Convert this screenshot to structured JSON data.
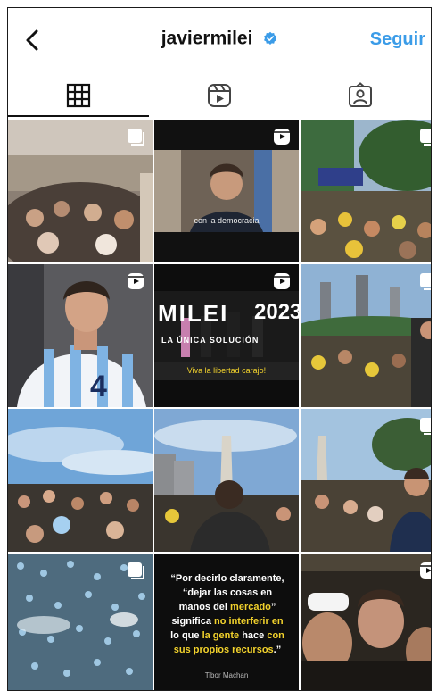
{
  "header": {
    "username": "javiermilei",
    "follow_label": "Seguir"
  },
  "tabs": [
    {
      "name": "grid",
      "icon": "grid-icon"
    },
    {
      "name": "reels",
      "icon": "reels-icon"
    },
    {
      "name": "tagged",
      "icon": "tagged-icon"
    }
  ],
  "posts": {
    "p2_caption": "con la democracia",
    "p5_banner": "MILEI",
    "p5_year": "2023",
    "p5_sub": "LA ÚNICA SOLUCIÓN",
    "p5_caption": "Viva la libertad carajo!",
    "p4_number": "4",
    "p11": {
      "quote_open": "“Por decirlo claramente,",
      "quote_line2": "“dejar las cosas en",
      "quote_line3_a": "manos del ",
      "quote_line3_b": "mercado",
      "quote_line3_c": "”",
      "quote_line4": "significa ",
      "quote_line4_hl": "no interferir en",
      "quote_line5_a": "lo que ",
      "quote_line5_hl": "la gente",
      "quote_line5_b": " hace ",
      "quote_line5_hl2": "con",
      "quote_line6_hl": "sus propios recursos",
      "quote_line6_end": ".”",
      "author": "Tibor Machan"
    }
  },
  "colors": {
    "accent": "#3b9ce8",
    "verified": "#3b9ce8",
    "highlight": "#f2d22c"
  }
}
